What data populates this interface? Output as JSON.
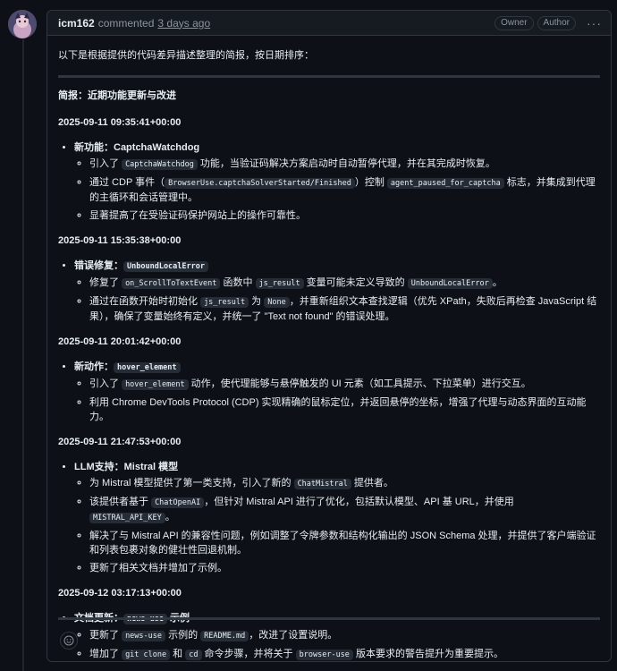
{
  "comment": {
    "author": "icm162",
    "action": "commented",
    "time": "3 days ago",
    "badges": [
      "Owner",
      "Author"
    ],
    "more_icon": "kebab-horizontal-icon",
    "intro": "以下是根据提供的代码差异描述整理的简报，按日期排序：",
    "heading": "简报：近期功能更新与改进",
    "reaction_icon": "smiley-icon"
  },
  "sections": [
    {
      "date": "2025-09-11 09:35:41+00:00",
      "title_prefix": "新功能：",
      "title_text": "CaptchaWatchdog",
      "title_code": "",
      "title_suffix": "",
      "items": [
        {
          "t1": "引入了 ",
          "c1": "CaptchaWatchdog",
          "t2": " 功能，当验证码解决方案启动时自动暂停代理，并在其完成时恢复。",
          "c2": "",
          "t3": "",
          "c3": "",
          "t4": ""
        },
        {
          "t1": "通过 CDP 事件（",
          "c1": "BrowserUse.captchaSolverStarted/Finished",
          "t2": "）控制 ",
          "c2": "agent_paused_for_captcha",
          "t3": " 标志，并集成到代理的主循环和会话管理中。",
          "c3": "",
          "t4": ""
        },
        {
          "t1": "显著提高了在受验证码保护网站上的操作可靠性。",
          "c1": "",
          "t2": "",
          "c2": "",
          "t3": "",
          "c3": "",
          "t4": ""
        }
      ]
    },
    {
      "date": "2025-09-11 15:35:38+00:00",
      "title_prefix": "错误修复：",
      "title_text": "",
      "title_code": "UnboundLocalError",
      "title_suffix": "",
      "items": [
        {
          "t1": "修复了 ",
          "c1": "on_ScrollToTextEvent",
          "t2": " 函数中 ",
          "c2": "js_result",
          "t3": " 变量可能未定义导致的 ",
          "c3": "UnboundLocalError",
          "t4": "。"
        },
        {
          "t1": "通过在函数开始时初始化 ",
          "c1": "js_result",
          "t2": " 为 ",
          "c2": "None",
          "t3": "，并重新组织文本查找逻辑（优先 XPath，失败后再检查 JavaScript 结果），确保了变量始终有定义，并统一了 \"Text not found\" 的错误处理。",
          "c3": "",
          "t4": ""
        }
      ]
    },
    {
      "date": "2025-09-11 20:01:42+00:00",
      "title_prefix": "新动作：",
      "title_text": "",
      "title_code": "hover_element",
      "title_suffix": "",
      "items": [
        {
          "t1": "引入了 ",
          "c1": "hover_element",
          "t2": " 动作，使代理能够与悬停触发的 UI 元素（如工具提示、下拉菜单）进行交互。",
          "c2": "",
          "t3": "",
          "c3": "",
          "t4": ""
        },
        {
          "t1": "利用 Chrome DevTools Protocol (CDP) 实现精确的鼠标定位，并返回悬停的坐标，增强了代理与动态界面的互动能力。",
          "c1": "",
          "t2": "",
          "c2": "",
          "t3": "",
          "c3": "",
          "t4": ""
        }
      ]
    },
    {
      "date": "2025-09-11 21:47:53+00:00",
      "title_prefix": "LLM支持：",
      "title_text": "Mistral 模型",
      "title_code": "",
      "title_suffix": "",
      "items": [
        {
          "t1": "为 Mistral 模型提供了第一类支持，引入了新的 ",
          "c1": "ChatMistral",
          "t2": " 提供者。",
          "c2": "",
          "t3": "",
          "c3": "",
          "t4": ""
        },
        {
          "t1": "该提供者基于 ",
          "c1": "ChatOpenAI",
          "t2": "，但针对 Mistral API 进行了优化，包括默认模型、API 基 URL，并使用 ",
          "c2": "MISTRAL_API_KEY",
          "t3": "。",
          "c3": "",
          "t4": ""
        },
        {
          "t1": "解决了与 Mistral API 的兼容性问题，例如调整了令牌参数和结构化输出的 JSON Schema 处理，并提供了客户端验证和列表包裹对象的健壮性回退机制。",
          "c1": "",
          "t2": "",
          "c2": "",
          "t3": "",
          "c3": "",
          "t4": ""
        },
        {
          "t1": "更新了相关文档并增加了示例。",
          "c1": "",
          "t2": "",
          "c2": "",
          "t3": "",
          "c3": "",
          "t4": ""
        }
      ]
    },
    {
      "date": "2025-09-12 03:17:13+00:00",
      "title_prefix": "文档更新：",
      "title_text": "",
      "title_code": "news-use",
      "title_suffix": " 示例",
      "items": [
        {
          "t1": "更新了 ",
          "c1": "news-use",
          "t2": " 示例的 ",
          "c2": "README.md",
          "t3": "，改进了设置说明。",
          "c3": "",
          "t4": ""
        },
        {
          "t1": "增加了 ",
          "c1": "git clone",
          "t2": " 和 ",
          "c2": "cd",
          "t3": " 命令步骤，并将关于 ",
          "c3": "browser-use",
          "t4": " 版本要求的警告提升为重要提示。"
        }
      ]
    }
  ]
}
